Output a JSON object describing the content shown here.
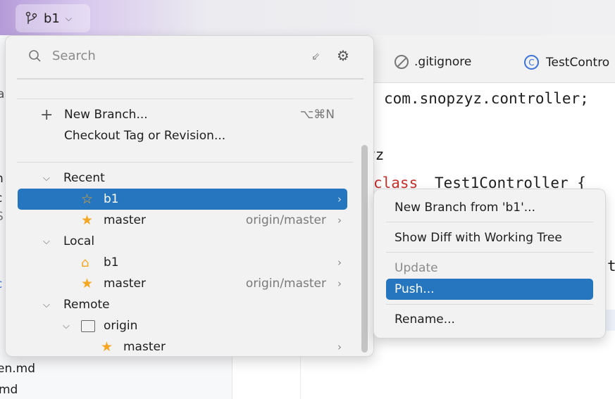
{
  "toolbar": {
    "branch": "b1"
  },
  "tabs": [
    {
      "label": ".gitignore",
      "icon": "ignore-icon"
    },
    {
      "label": "TestContro",
      "icon": "class-icon"
    }
  ],
  "code": {
    "line1": "com.snopzyz.controller;",
    "line2": "yz",
    "keyword": "class",
    "classname": "Test1Controller {",
    "line4": "t"
  },
  "left_panel": {
    "items": [
      "a",
      "n",
      "c",
      "S",
      "c",
      "en.md",
      "md"
    ]
  },
  "popup": {
    "search_placeholder": "Search",
    "actions": [
      {
        "label": "New Branch...",
        "shortcut": "⌥⌘N"
      },
      {
        "label": "Checkout Tag or Revision..."
      }
    ],
    "groups": {
      "recent": "Recent",
      "local": "Local",
      "remote": "Remote",
      "origin": "origin"
    },
    "recent": [
      {
        "name": "b1",
        "icon": "star-outline-icon",
        "selected": true
      },
      {
        "name": "master",
        "tracking": "origin/master",
        "icon": "star-icon"
      }
    ],
    "local": [
      {
        "name": "b1",
        "icon": "tag-icon"
      },
      {
        "name": "master",
        "tracking": "origin/master",
        "icon": "star-icon"
      }
    ],
    "remote": [
      {
        "name": "master",
        "icon": "star-icon"
      }
    ]
  },
  "context_menu": {
    "items": [
      "New Branch from 'b1'...",
      "Show Diff with Working Tree",
      "Update",
      "Push...",
      "Rename..."
    ],
    "disabled": "Update",
    "selected": "Push..."
  },
  "colors": {
    "accent": "#2675bf",
    "star": "#f5a623",
    "keyword": "#c9302c"
  }
}
